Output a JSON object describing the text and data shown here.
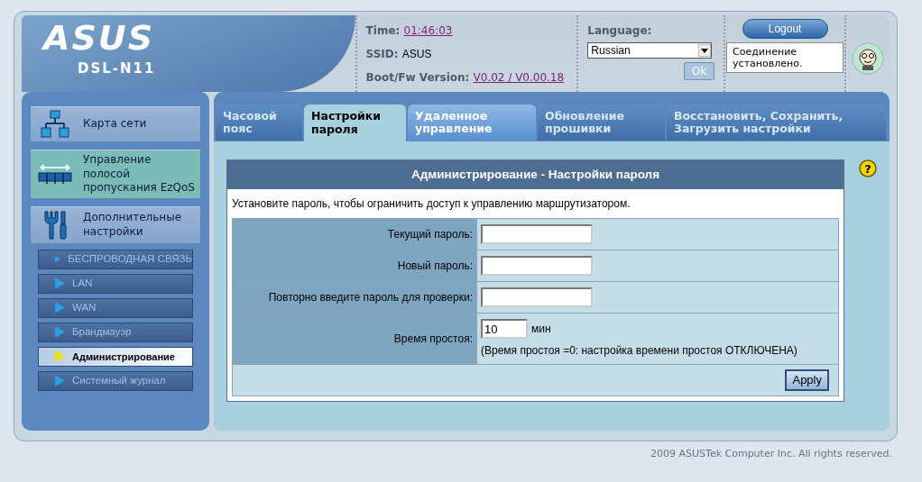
{
  "header": {
    "brand": "ASUS",
    "model": "DSL-N11",
    "time_label": "Time:",
    "time": "01:46:03",
    "ssid_label": "SSID:",
    "ssid": "ASUS",
    "fw_label": "Boot/Fw Version:",
    "fw": "V0.02 / V0.00.18",
    "language_label": "Language:",
    "language": "Russian",
    "ok_button": "Ok",
    "logout_button": "Logout",
    "status": "Соединение установлено."
  },
  "sidebar": {
    "items": [
      {
        "label": "Карта сети",
        "kind": "network",
        "highlighted": false
      },
      {
        "label": "Управление полосой пропускания EzQoS",
        "kind": "qos",
        "highlighted": true
      },
      {
        "label": "Дополнительные настройки",
        "kind": "tools",
        "highlighted": false
      }
    ],
    "subitems": [
      {
        "label": "БЕСПРОВОДНАЯ СВЯЗЬ",
        "selected": false
      },
      {
        "label": "LAN",
        "selected": false
      },
      {
        "label": "WAN",
        "selected": false
      },
      {
        "label": "Брандмауэр",
        "selected": false
      },
      {
        "label": "Администрирование",
        "selected": true
      },
      {
        "label": "Системный журнал",
        "selected": false
      }
    ]
  },
  "tabs": [
    {
      "label": "Часовой пояс",
      "selected": false,
      "disabled": true
    },
    {
      "label": "Настройки пароля",
      "selected": true,
      "disabled": false
    },
    {
      "label": "Удаленное управление",
      "selected": false,
      "disabled": false
    },
    {
      "label": "Обновление прошивки",
      "selected": false,
      "disabled": true
    },
    {
      "label": "Восстановить, Сохранить, Загрузить настройки",
      "selected": false,
      "disabled": true
    }
  ],
  "form": {
    "title": "Администрирование - Настройки пароля",
    "description": "Установите пароль, чтобы ограничить доступ к управлению маршрутизатором.",
    "rows": [
      {
        "label": "Текущий пароль:",
        "kind": "password"
      },
      {
        "label": "Новый пароль:",
        "kind": "password"
      },
      {
        "label": "Повторно введите пароль для проверки:",
        "kind": "password"
      },
      {
        "label": "Время простоя:",
        "kind": "idle",
        "value": "10",
        "unit": "мин",
        "note": "(Время простоя =0: настройка времени простоя ОТКЛЮЧЕНА)"
      }
    ],
    "apply_button": "Apply",
    "help": "?"
  },
  "footer": "2009 ASUSTek Computer Inc. All rights reserved."
}
